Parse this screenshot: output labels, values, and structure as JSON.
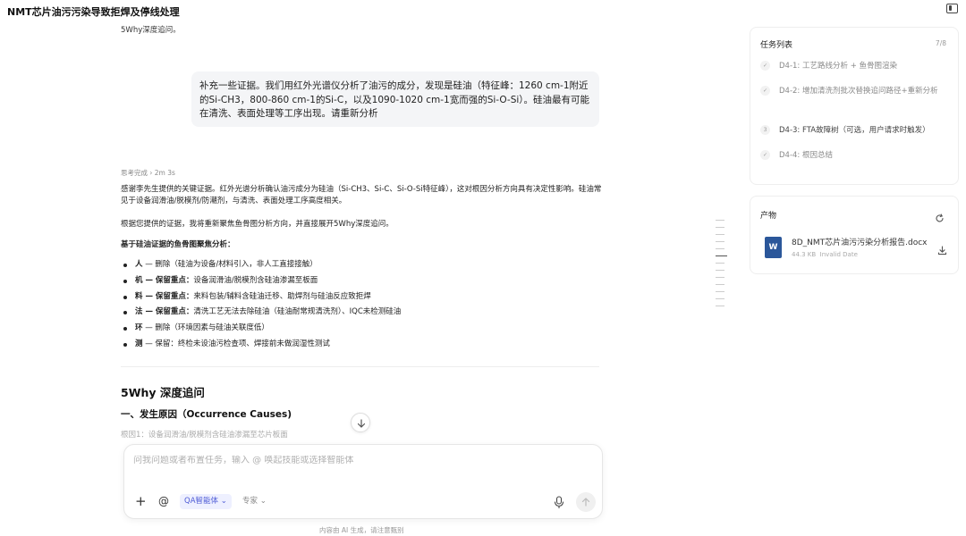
{
  "header": {
    "title": "NMT芯片油污污染导致拒焊及停线处理"
  },
  "chat": {
    "prev_text": "5Why深度追问。",
    "user_message": "补充一些证据。我们用红外光谱仪分析了油污的成分，发现是硅油（特征峰：1260 cm-1附近的Si-CH3，800-860 cm-1的Si-C，以及1090-1020 cm-1宽而强的Si-O-Si）。硅油最有可能在清洗、表面处理等工序出现。请重新分析",
    "thinking_label": "思考完成",
    "thinking_time": "2m 3s",
    "answer": {
      "p1": "感谢李先生提供的关键证据。红外光谱分析确认油污成分为硅油（Si-CH3、Si-C、Si-O-Si特征峰），这对根因分析方向具有决定性影响。硅油常见于设备润滑油/脱模剂/防潮剂，与清洗、表面处理工序高度相关。",
      "p2": "根据您提供的证据，我将重新聚焦鱼骨图分析方向，并直接展开5Why深度追问。",
      "p3": "基于硅油证据的鱼骨图聚焦分析：",
      "bullets": [
        {
          "key": "人",
          "text": " — 删除（硅油为设备/材料引入，非人工直接接触）"
        },
        {
          "key": "机 — 保留重点：",
          "text": "设备润滑油/脱模剂含硅油渗漏至板面"
        },
        {
          "key": "料 — 保留重点：",
          "text": "来料包装/辅料含硅油迁移、助焊剂与硅油反应致拒焊"
        },
        {
          "key": "法 — 保留重点：",
          "text": "清洗工艺无法去除硅油（硅油耐常规清洗剂）、IQC未检测硅油"
        },
        {
          "key": "环",
          "text": " — 删除（环境因素与硅油关联度低）"
        },
        {
          "key": "测",
          "text": " — 保留：终检未设油污检查项、焊接前未做润湿性测试"
        }
      ]
    },
    "section_title": "5Why 深度追问",
    "subsection_title": "一、发生原因（Occurrence Causes)",
    "faded_text": "根因1：设备润滑油/脱模剂含硅油渗漏至芯片板面"
  },
  "composer": {
    "placeholder": "问我问题或者布置任务，输入 @ 唤起技能或选择智能体",
    "agent_label": "QA智能体 ⌄",
    "expert_label": "专家 ⌄",
    "disclaimer": "内容由 AI 生成，请注意甄别"
  },
  "tasks": {
    "title": "任务列表",
    "count": "7/8",
    "items": [
      {
        "badge": "✓",
        "label": "D4-1: 工艺路线分析 + 鱼骨图渲染"
      },
      {
        "badge": "✓",
        "label": "D4-2: 增加清洗剂批次替换追问路径+重新分析"
      },
      {
        "badge": "3",
        "label": "D4-3: FTA故障树（可选，用户请求时触发）"
      },
      {
        "badge": "✓",
        "label": "D4-4: 根因总结"
      }
    ]
  },
  "artifacts": {
    "title": "产物",
    "file_name": "8D_NMT芯片油污污染分析报告.docx",
    "file_size": "44.3 KB",
    "file_date": "Invalid Date",
    "file_type_letter": "W"
  },
  "colors": {
    "accent": "#4e5bd6",
    "word_blue": "#2b579a"
  }
}
